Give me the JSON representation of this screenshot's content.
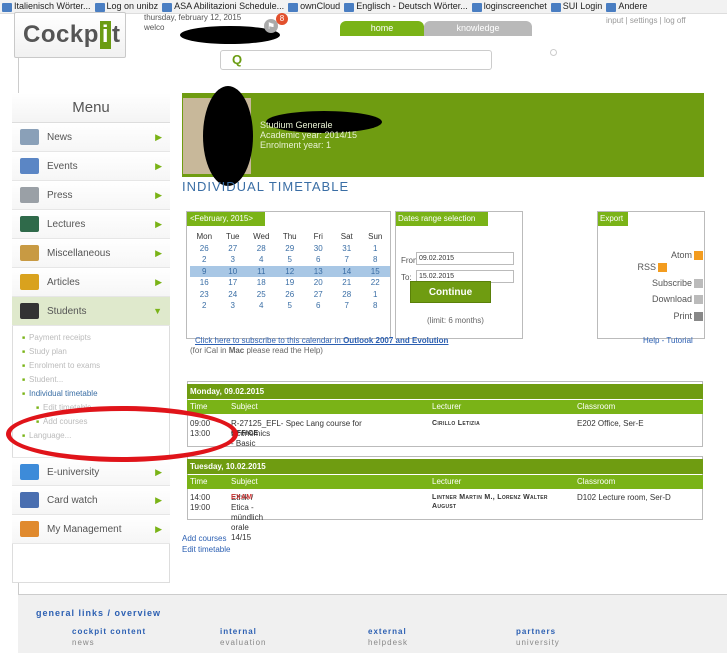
{
  "bookmarks": [
    "Italienisch Wörter...",
    "Log on unibz",
    "ASA Abilitazioni Schedule...",
    "ownCloud",
    "Englisch - Deutsch Wörter...",
    "loginscreenchet",
    "SUI Login",
    "Andere"
  ],
  "header": {
    "logo_text": "Cockp",
    "logo_i": "i",
    "logo_t": "t",
    "date": "thursday, february 12, 2015",
    "welcome": "welco",
    "notif_count": "8",
    "tabs": {
      "home": "home",
      "knowledge": "knowledge"
    },
    "top_links": "input | settings | log off",
    "search_icon": "Q"
  },
  "menu": {
    "title": "Menu",
    "items": [
      {
        "label": "News",
        "icon": "news-icon",
        "color": "#8aa0b8"
      },
      {
        "label": "Events",
        "icon": "calendar-icon",
        "color": "#5b86c5"
      },
      {
        "label": "Press",
        "icon": "newspaper-icon",
        "color": "#9aa0a6"
      },
      {
        "label": "Lectures",
        "icon": "blackboard-icon",
        "color": "#2f6a4a"
      },
      {
        "label": "Miscellaneous",
        "icon": "box-icon",
        "color": "#c89a43"
      },
      {
        "label": "Articles",
        "icon": "pen-icon",
        "color": "#d9a21e"
      },
      {
        "label": "Students",
        "icon": "student-icon",
        "color": "#333333"
      },
      {
        "label": "E-university",
        "icon": "monitor-icon",
        "color": "#3d8bd9"
      },
      {
        "label": "Card watch",
        "icon": "card-icon",
        "color": "#4a6fb0"
      },
      {
        "label": "My Management",
        "icon": "management-icon",
        "color": "#e08a2e"
      }
    ],
    "students_sub": [
      "Payment receipts",
      "Study plan",
      "Enrolment to exams",
      "Student...",
      "Individual timetable",
      "Edit timetable",
      "Add courses",
      "Language..."
    ]
  },
  "profile": {
    "line1": "Studium Generale",
    "line2": "Academic year: 2014/15",
    "line3": "Enrolment year: 1"
  },
  "page_title": "INDIVIDUAL TIMETABLE",
  "calendar": {
    "header": "<February, 2015>",
    "days": [
      "Mon",
      "Tue",
      "Wed",
      "Thu",
      "Fri",
      "Sat",
      "Sun"
    ],
    "weeks": [
      [
        "26",
        "27",
        "28",
        "29",
        "30",
        "31",
        "1"
      ],
      [
        "2",
        "3",
        "4",
        "5",
        "6",
        "7",
        "8"
      ],
      [
        "9",
        "10",
        "11",
        "12",
        "13",
        "14",
        "15"
      ],
      [
        "16",
        "17",
        "18",
        "19",
        "20",
        "21",
        "22"
      ],
      [
        "23",
        "24",
        "25",
        "26",
        "27",
        "28",
        "1"
      ],
      [
        "2",
        "3",
        "4",
        "5",
        "6",
        "7",
        "8"
      ]
    ]
  },
  "date_range": {
    "header": "Dates range selection",
    "from_label": "From:",
    "from_value": "09.02.2015",
    "to_label": "To:",
    "to_value": "15.02.2015",
    "continue": "Continue",
    "limit": "(limit: 6 months)"
  },
  "export": {
    "header": "Export",
    "atom": "Atom",
    "rss": "RSS",
    "subscribe": "Subscribe",
    "download": "Download",
    "print": "Print"
  },
  "subscribe_link": {
    "pre": "Click here to subscribe to this calendar in ",
    "bold": "Outlook 2007 and Evolution",
    "note_pre": "(for iCal in ",
    "note_bold": "Mac",
    "note_post": " please read the Help)"
  },
  "help": "Help - Tutorial",
  "columns": {
    "time": "Time",
    "subject": "Subject",
    "lecturer": "Lecturer",
    "classroom": "Classroom"
  },
  "days_list": [
    {
      "heading": "Monday, 09.02.2015",
      "start": "09:00",
      "end": "13:00",
      "subject1": "R-27125_EFL- Spec Lang course for",
      "subject2": "Economics - Basic",
      "tag": "OFFICE",
      "lecturer1": "Cirillo Letizia",
      "lecturer2": "",
      "classroom": "E202 Office, Ser-E"
    },
    {
      "heading": "Tuesday, 10.02.2015",
      "start": "14:00",
      "end": "19:00",
      "subject1": "Ethik / Etica - mündlich orale 14/15",
      "subject2": "",
      "tag": "EXAM",
      "lecturer1": "Lintner Martin M., Lorenz Walter",
      "lecturer2": "August",
      "classroom": "D102 Lecture room, Ser-D"
    }
  ],
  "bottom_links": {
    "add": "Add courses",
    "edit": "Edit timetable"
  },
  "footer": {
    "title": "general links / overview",
    "cols": [
      {
        "title": "cockpit content",
        "item": "news"
      },
      {
        "title": "internal",
        "item": "evaluation"
      },
      {
        "title": "external",
        "item": "helpdesk"
      },
      {
        "title": "partners",
        "item": "university"
      }
    ]
  },
  "annotation_color": "#e0141a",
  "accent": "#7ab317"
}
